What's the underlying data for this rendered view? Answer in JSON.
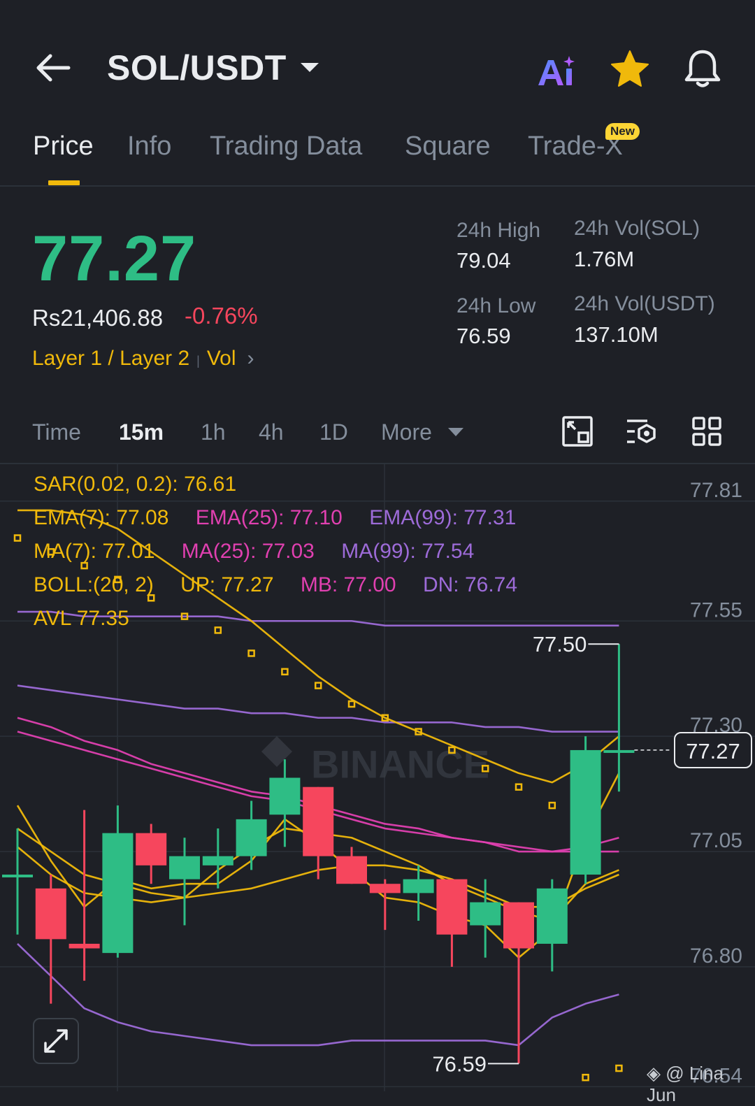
{
  "header": {
    "pair": "SOL/USDT",
    "ai_label": "Ai"
  },
  "tabs": [
    {
      "label": "Price",
      "active": true
    },
    {
      "label": "Info"
    },
    {
      "label": "Trading Data"
    },
    {
      "label": "Square"
    },
    {
      "label": "Trade-X",
      "badge": "New"
    }
  ],
  "price": {
    "last": "77.27",
    "fiat": "Rs21,406.88",
    "change": "-0.76%",
    "tag1": "Layer 1 / Layer 2",
    "tag2": "Vol"
  },
  "stats": {
    "high_label": "24h High",
    "high_value": "79.04",
    "low_label": "24h Low",
    "low_value": "76.59",
    "vol_sol_label": "24h Vol(SOL)",
    "vol_sol_value": "1.76M",
    "vol_usdt_label": "24h Vol(USDT)",
    "vol_usdt_value": "137.10M"
  },
  "timeframes": [
    {
      "label": "Time"
    },
    {
      "label": "15m",
      "active": true
    },
    {
      "label": "1h"
    },
    {
      "label": "4h"
    },
    {
      "label": "1D"
    },
    {
      "label": "More"
    }
  ],
  "indicators": {
    "sar": "SAR(0.02, 0.2): 76.61",
    "ema7": "EMA(7): 77.08",
    "ema25": "EMA(25): 77.10",
    "ema99": "EMA(99): 77.31",
    "ma7": "MA(7): 77.01",
    "ma25": "MA(25): 77.03",
    "ma99": "MA(99): 77.54",
    "boll": "BOLL:(20, 2)",
    "boll_up": "UP: 77.27",
    "boll_mb": "MB: 77.00",
    "boll_dn": "DN: 76.74",
    "avl": "AVL 77.35"
  },
  "chart": {
    "current_price_tag": "77.27",
    "high_marker": "77.50",
    "low_marker": "76.59",
    "watermark": "BINANCE",
    "credit": "@ Lina Jun"
  },
  "colors": {
    "up": "#2ebd85",
    "down": "#f6465d",
    "accent": "#f0b90b",
    "pink": "#e040b0",
    "purple": "#9d6bd8"
  },
  "chart_data": {
    "type": "candlestick",
    "interval": "15m",
    "y_ticks": [
      "77.81",
      "77.55",
      "77.30",
      "77.05",
      "76.80",
      "76.54"
    ],
    "ylim": [
      76.53,
      77.89
    ],
    "candles": [
      {
        "o": 77.0,
        "h": 77.1,
        "l": 76.87,
        "c": 77.0
      },
      {
        "o": 76.97,
        "h": 77.0,
        "l": 76.72,
        "c": 76.86
      },
      {
        "o": 76.85,
        "h": 77.14,
        "l": 76.77,
        "c": 76.84
      },
      {
        "o": 76.83,
        "h": 77.15,
        "l": 76.82,
        "c": 77.09
      },
      {
        "o": 77.09,
        "h": 77.11,
        "l": 76.98,
        "c": 77.02
      },
      {
        "o": 76.99,
        "h": 77.08,
        "l": 76.89,
        "c": 77.04
      },
      {
        "o": 77.02,
        "h": 77.1,
        "l": 76.97,
        "c": 77.04
      },
      {
        "o": 77.04,
        "h": 77.16,
        "l": 77.01,
        "c": 77.12
      },
      {
        "o": 77.13,
        "h": 77.25,
        "l": 77.06,
        "c": 77.21
      },
      {
        "o": 77.19,
        "h": 77.19,
        "l": 76.99,
        "c": 77.04
      },
      {
        "o": 77.04,
        "h": 77.06,
        "l": 76.98,
        "c": 76.98
      },
      {
        "o": 76.98,
        "h": 76.99,
        "l": 76.88,
        "c": 76.96
      },
      {
        "o": 76.96,
        "h": 77.02,
        "l": 76.9,
        "c": 76.99
      },
      {
        "o": 76.99,
        "h": 76.99,
        "l": 76.8,
        "c": 76.87
      },
      {
        "o": 76.89,
        "h": 76.99,
        "l": 76.82,
        "c": 76.94
      },
      {
        "o": 76.94,
        "h": 76.94,
        "l": 76.59,
        "c": 76.84
      },
      {
        "o": 76.85,
        "h": 76.99,
        "l": 76.79,
        "c": 76.97
      },
      {
        "o": 77.0,
        "h": 77.3,
        "l": 76.98,
        "c": 77.27
      },
      {
        "o": 77.27,
        "h": 77.5,
        "l": 77.18,
        "c": 77.27
      }
    ],
    "series": [
      {
        "name": "MA(99)",
        "color": "#9d6bd8",
        "values": [
          77.57,
          77.57,
          77.56,
          77.56,
          77.56,
          77.56,
          77.56,
          77.55,
          77.55,
          77.55,
          77.55,
          77.54,
          77.54,
          77.54,
          77.54,
          77.54,
          77.54,
          77.54,
          77.54
        ]
      },
      {
        "name": "EMA(99)",
        "color": "#9d6bd8",
        "values": [
          77.41,
          77.4,
          77.39,
          77.38,
          77.37,
          77.36,
          77.36,
          77.35,
          77.35,
          77.34,
          77.34,
          77.33,
          77.33,
          77.33,
          77.32,
          77.32,
          77.31,
          77.31,
          77.31
        ]
      },
      {
        "name": "EMA(7)",
        "color": "#f0b90b",
        "values": [
          77.79,
          77.79,
          77.78,
          77.75,
          77.7,
          77.65,
          77.6,
          77.55,
          77.49,
          77.43,
          77.38,
          77.34,
          77.31,
          77.28,
          77.25,
          77.22,
          77.2,
          77.24,
          77.3
        ]
      },
      {
        "name": "MA(25)",
        "color": "#e040b0",
        "values": [
          77.34,
          77.32,
          77.29,
          77.27,
          77.24,
          77.22,
          77.2,
          77.18,
          77.17,
          77.15,
          77.13,
          77.11,
          77.1,
          77.08,
          77.07,
          77.06,
          77.05,
          77.06,
          77.08
        ]
      },
      {
        "name": "EMA(25)",
        "color": "#e040b0",
        "values": [
          77.31,
          77.29,
          77.27,
          77.25,
          77.23,
          77.21,
          77.19,
          77.17,
          77.16,
          77.14,
          77.12,
          77.1,
          77.09,
          77.08,
          77.07,
          77.05,
          77.05,
          77.05,
          77.05
        ]
      },
      {
        "name": "BOLL MB",
        "color": "#f0b90b",
        "values": [
          77.1,
          77.05,
          77.0,
          76.98,
          76.96,
          76.95,
          76.96,
          76.97,
          76.99,
          77.01,
          77.02,
          77.02,
          77.01,
          76.99,
          76.96,
          76.93,
          76.93,
          76.97,
          77.0
        ]
      },
      {
        "name": "MA(7)",
        "color": "#f0b90b",
        "values": [
          77.06,
          77.0,
          76.96,
          76.95,
          76.94,
          76.95,
          77.01,
          77.06,
          77.1,
          77.09,
          77.08,
          77.05,
          77.02,
          76.98,
          76.95,
          76.92,
          76.9,
          76.98,
          77.01
        ]
      },
      {
        "name": "BOLL DN",
        "color": "#9d6bd8",
        "values": [
          76.85,
          76.78,
          76.71,
          76.68,
          76.66,
          76.65,
          76.64,
          76.63,
          76.63,
          76.63,
          76.64,
          76.64,
          76.64,
          76.64,
          76.64,
          76.63,
          76.69,
          76.72,
          76.74
        ]
      },
      {
        "name": "Trend",
        "color": "#f0b90b",
        "values": [
          77.15,
          77.03,
          76.93,
          76.99,
          76.97,
          76.98,
          76.98,
          77.03,
          77.12,
          77.07,
          77.01,
          76.95,
          76.94,
          76.91,
          76.89,
          76.82,
          76.88,
          77.08,
          77.22
        ]
      }
    ],
    "sar": [
      77.73,
      77.7,
      77.67,
      77.64,
      77.6,
      77.56,
      77.53,
      77.48,
      77.44,
      77.41,
      77.37,
      77.34,
      77.31,
      77.27,
      77.23,
      77.19,
      77.15,
      76.56,
      76.58
    ],
    "watermark_dots": [
      77.24,
      77.24,
      77.24,
      77.22
    ]
  }
}
